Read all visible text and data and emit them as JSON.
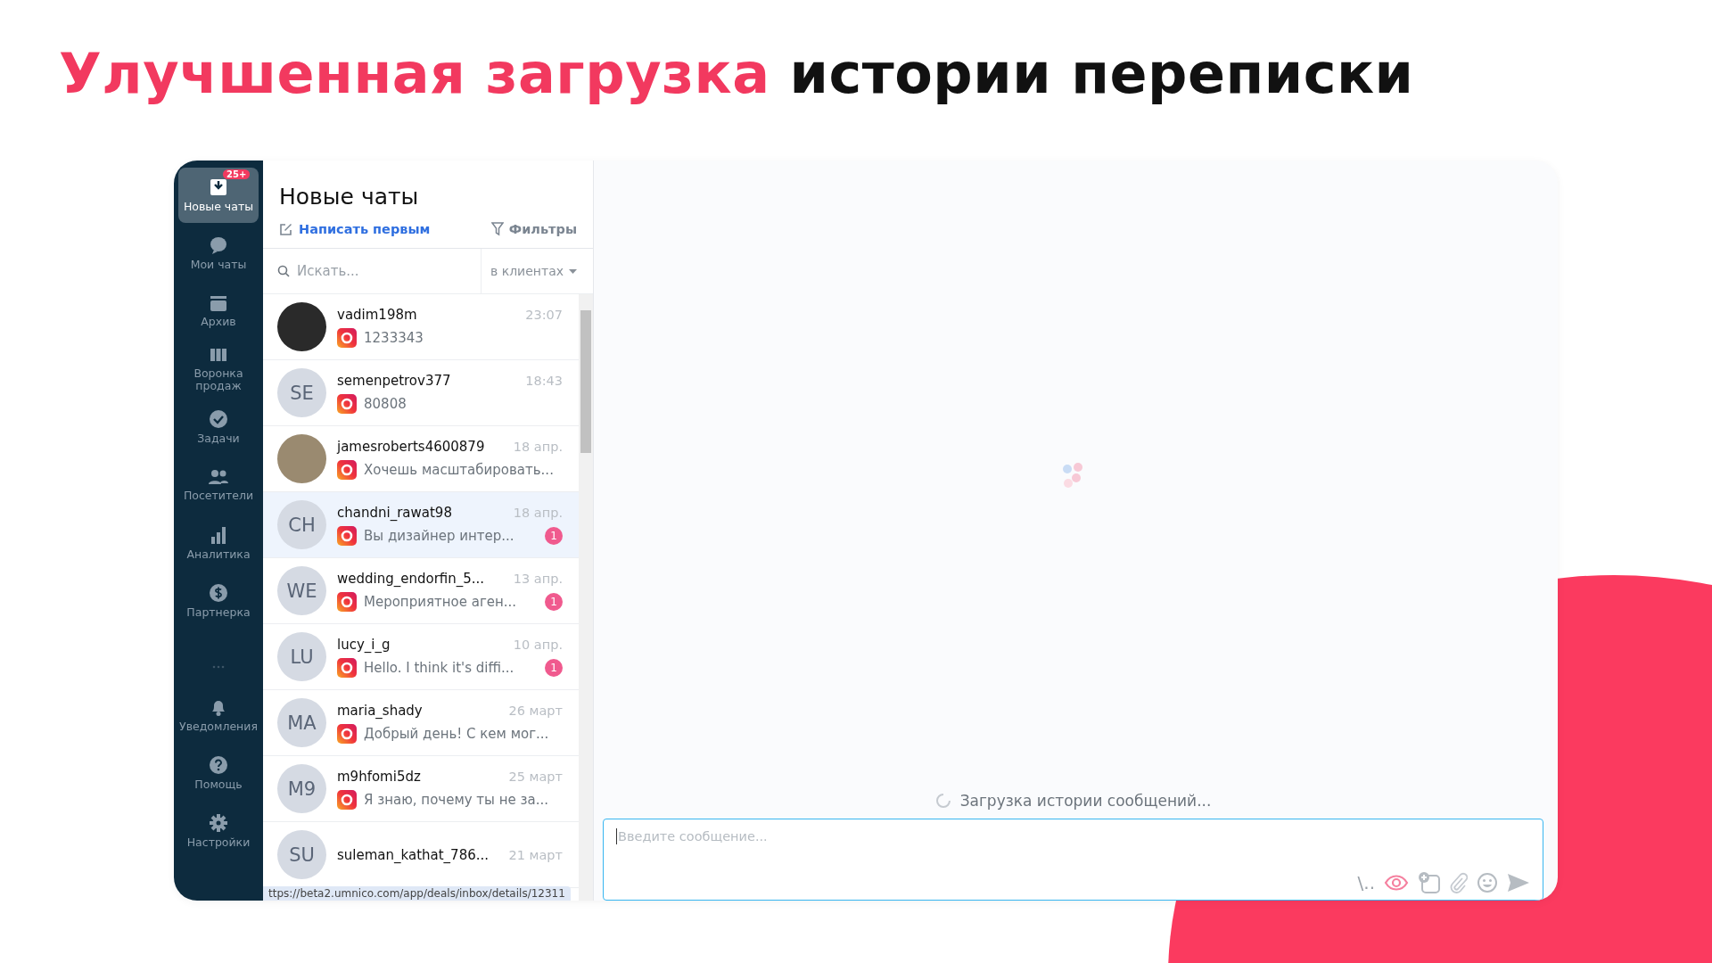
{
  "headline": {
    "accent": "Улучшенная загрузка",
    "rest": "истории переписки"
  },
  "sidebar": {
    "items": [
      {
        "label": "Новые чаты",
        "selected": true,
        "badge": "25+"
      },
      {
        "label": "Мои чаты",
        "selected": false
      },
      {
        "label": "Архив",
        "selected": false
      },
      {
        "label": "Воронка продаж",
        "selected": false
      },
      {
        "label": "Задачи",
        "selected": false
      },
      {
        "label": "Посетители",
        "selected": false
      },
      {
        "label": "Аналитика",
        "selected": false
      },
      {
        "label": "Партнерка",
        "selected": false
      }
    ],
    "bottom_items": [
      {
        "label": "Уведомления",
        "selected": false
      },
      {
        "label": "Помощь",
        "selected": false
      },
      {
        "label": "Настройки",
        "selected": false
      }
    ]
  },
  "chat_list": {
    "title": "Новые чаты",
    "write_first": "Написать первым",
    "filters": "Фильтры",
    "search": {
      "placeholder": "Искать..."
    },
    "scope": "в клиентах",
    "chats": [
      {
        "name": "vadim198m",
        "time": "23:07",
        "preview": "1233343",
        "selected": false
      },
      {
        "initials": "SE",
        "name": "semenpetrov377",
        "time": "18:43",
        "preview": "80808",
        "selected": false
      },
      {
        "name": "jamesroberts4600879",
        "time": "18 апр.",
        "preview": "Хочешь масштабировать...",
        "selected": false
      },
      {
        "initials": "CH",
        "name": "chandni_rawat98",
        "time": "18 апр.",
        "preview": "Вы дизайнер интер...",
        "unread": "1",
        "selected": true
      },
      {
        "initials": "WE",
        "name": "wedding_endorfin_5...",
        "time": "13 апр.",
        "preview": "Мероприятное аген...",
        "unread": "1",
        "selected": false
      },
      {
        "initials": "LU",
        "name": "lucy_i_g",
        "time": "10 апр.",
        "preview": "Hello. I think it's diffi...",
        "unread": "1",
        "selected": false
      },
      {
        "initials": "MA",
        "name": "maria_shady",
        "time": "26 март",
        "preview": "Добрый день! С кем мог...",
        "selected": false
      },
      {
        "initials": "M9",
        "name": "m9hfomi5dz",
        "time": "25 март",
        "preview": "Я знаю, почему ты не за...",
        "selected": false
      },
      {
        "initials": "SU",
        "name": "suleman_kathat_786...",
        "time": "21 март",
        "selected": false
      }
    ]
  },
  "status_url": "ttps://beta2.umnico.com/app/deals/inbox/details/12311",
  "conversation": {
    "loading_text": "Загрузка истории сообщений...",
    "composer": {
      "placeholder": "Введите сообщение...",
      "shortcut": "\\.."
    }
  }
}
